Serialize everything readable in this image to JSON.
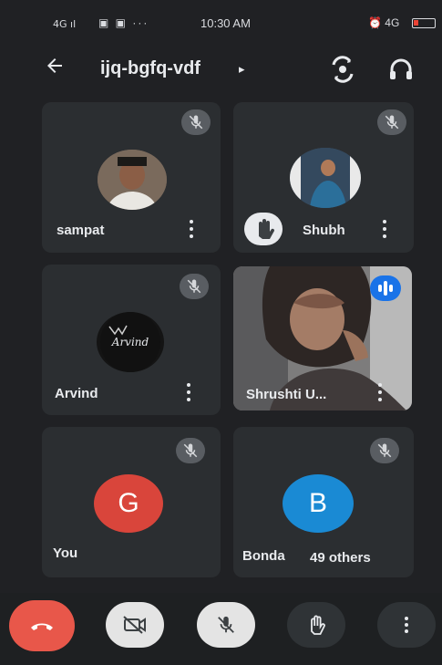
{
  "status_bar": {
    "signal": "4G ıl",
    "apps": "▣ ▣ ···",
    "time": "10:30 AM",
    "right": "⏰ 4G"
  },
  "header": {
    "meeting_code": "ijq-bgfq-vdf",
    "caret": "▸"
  },
  "participants": [
    {
      "name": "sampat",
      "muted": true
    },
    {
      "name": "Shubh",
      "muted": true,
      "hand_raised": true
    },
    {
      "name": "Arvind",
      "muted": true,
      "avatar_text": "Arvind"
    },
    {
      "name": "Shrushti U...",
      "speaking": true
    },
    {
      "name": "You",
      "muted": true,
      "initial": "G",
      "avatar_color": "#d9453b"
    },
    {
      "name": "Bonda",
      "muted": true,
      "initial": "B",
      "avatar_color": "#1a8ad4",
      "others_label": "49 others"
    }
  ],
  "colors": {
    "end_call": "#e8574a",
    "control_light": "#e4e4e4",
    "control_dark": "#2f3336",
    "speaking": "#1a73e8"
  }
}
